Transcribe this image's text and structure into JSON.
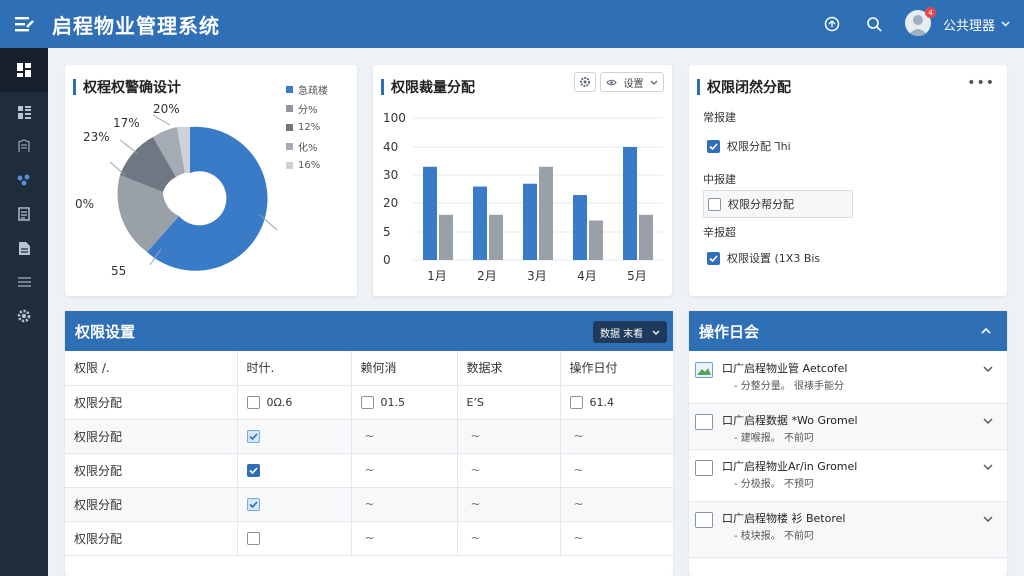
{
  "header": {
    "title": "启程物业管理系统",
    "user_name": "公共理器",
    "notif_count": "4"
  },
  "pie_card": {
    "title": "权程权警确设计",
    "slice_labels": [
      "20%",
      "17%",
      "23%",
      "0%",
      "55"
    ],
    "legend": [
      {
        "label": "急疏楼",
        "color": "#3a7bc8"
      },
      {
        "label": "分%",
        "color": "#8e959e"
      },
      {
        "label": "12%",
        "color": "#6f7782"
      },
      {
        "label": "化%",
        "color": "#a4abb4"
      },
      {
        "label": "16%",
        "color": "#cdd2d8"
      }
    ]
  },
  "bar_card": {
    "title": "权限裁量分配",
    "select_label": "设置"
  },
  "chart_data": {
    "type": "bar",
    "categories": [
      "1月",
      "2月",
      "3月",
      "4月",
      "5月"
    ],
    "series": [
      {
        "values": [
          33,
          26,
          27,
          23,
          40
        ],
        "color": "#3a7bc8"
      },
      {
        "values": [
          16,
          16,
          33,
          14,
          16
        ],
        "color": "#9aa0a8"
      }
    ],
    "ylim": [
      0,
      50
    ],
    "yticks": [
      "0",
      "5",
      "20",
      "30",
      "40",
      "100"
    ]
  },
  "perm_dist": {
    "title": "权限闭然分配",
    "section1_label": "常报建",
    "opt1": "权限分配 ⅂hi",
    "section2_label": "中报建",
    "opt2": "权限分帮分配",
    "section3_label": "辛报超",
    "opt3": "权限设置 (1X3 Bis"
  },
  "settings_panel": {
    "title": "权限设置",
    "filter_label": "数据 末看",
    "columns": [
      "权限 /.",
      "时什.",
      "赖何消",
      "数据求",
      "操作日付"
    ],
    "rows": [
      {
        "name": "权限分配",
        "c1": "0Ω.6",
        "c2": "01.5",
        "c3": "E’S",
        "c4": "61.4"
      },
      {
        "name": "权限分配",
        "c1": "",
        "c2": "~",
        "c3": "~",
        "c4": "~"
      },
      {
        "name": "权限分配",
        "c1": "",
        "c2": "~",
        "c3": "~",
        "c4": "~"
      },
      {
        "name": "权限分配",
        "c1": "",
        "c2": "~",
        "c3": "~",
        "c4": "~"
      },
      {
        "name": "权限分配",
        "c1": "",
        "c2": "~",
        "c3": "~",
        "c4": "~"
      }
    ]
  },
  "log_panel": {
    "title": "操作日会",
    "items": [
      {
        "title": "口广启程物业管 Aetcofel",
        "sub": "- 分整分量。 很裱手能分"
      },
      {
        "title": "口广启程数据 *Wo Gromel",
        "sub": "- 建喉报。 不前叼"
      },
      {
        "title": "口广启程物业Ar/in Gromel",
        "sub": "- 分极报。 不预叼"
      },
      {
        "title": "口广启程物楼 衫 Betorel",
        "sub": "- 枝块报。 不前叼"
      }
    ]
  }
}
